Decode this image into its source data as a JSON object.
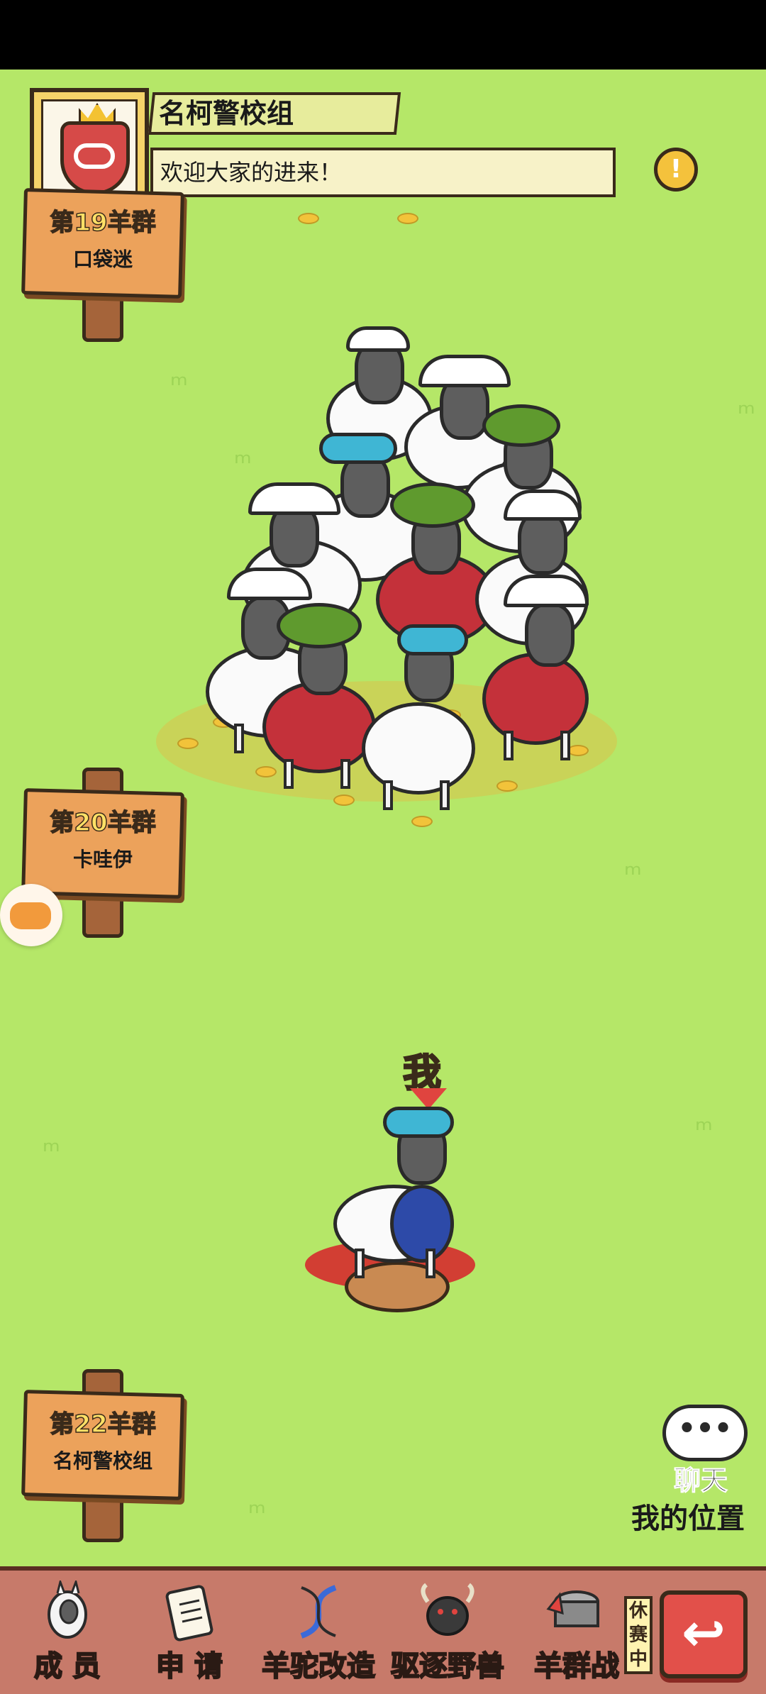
{
  "group": {
    "name": "名柯警校组",
    "welcome": "欢迎大家的进来！",
    "alert_icon": "!"
  },
  "signs": [
    {
      "rank": "第19羊群",
      "name": "口袋迷"
    },
    {
      "rank": "第20羊群",
      "name": "卡哇伊"
    },
    {
      "rank": "第22羊群",
      "name": "名柯警校组"
    }
  ],
  "me": {
    "label": "我"
  },
  "chat": {
    "bubble": "•••",
    "label": "聊天",
    "position": "我的位置"
  },
  "nav": {
    "members": "成 员",
    "apply": "申 请",
    "modify": "羊驼改造",
    "expel": "驱逐野兽",
    "battle": "羊群战",
    "battle_status": "休赛中",
    "back_icon": "↩"
  },
  "colors": {
    "grass": "#b5e768",
    "sign": "#eca25b",
    "bar": "#c77a6a",
    "back": "#e2504a"
  }
}
